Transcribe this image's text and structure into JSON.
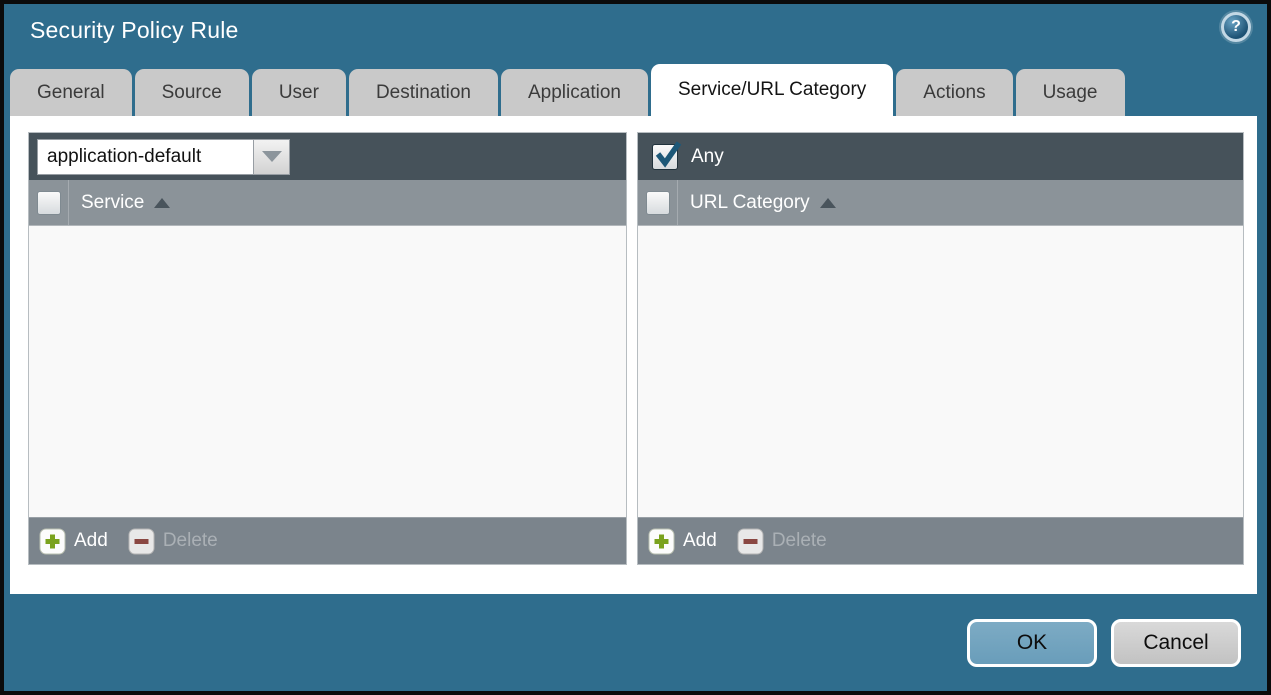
{
  "window": {
    "title": "Security Policy Rule"
  },
  "help": {
    "glyph": "?"
  },
  "tabs": [
    {
      "label": "General",
      "active": false
    },
    {
      "label": "Source",
      "active": false
    },
    {
      "label": "User",
      "active": false
    },
    {
      "label": "Destination",
      "active": false
    },
    {
      "label": "Application",
      "active": false
    },
    {
      "label": "Service/URL Category",
      "active": true
    },
    {
      "label": "Actions",
      "active": false
    },
    {
      "label": "Usage",
      "active": false
    }
  ],
  "service_panel": {
    "dropdown_value": "application-default",
    "column_header": "Service",
    "sort_order": "ascending",
    "rows": [],
    "add_label": "Add",
    "delete_label": "Delete",
    "delete_enabled": false
  },
  "url_category_panel": {
    "any_label": "Any",
    "any_checked": true,
    "column_header": "URL Category",
    "sort_order": "ascending",
    "rows": [],
    "add_label": "Add",
    "delete_label": "Delete",
    "delete_enabled": false
  },
  "footer": {
    "ok_label": "OK",
    "cancel_label": "Cancel"
  },
  "colors": {
    "frame_teal": "#2f6d8d",
    "dialog_border": "#0b0b0b",
    "toolbar_dark": "#46525a",
    "header_gray": "#8b9399",
    "footer_bar_gray": "#7b848c",
    "tab_inactive": "#c9c9c9",
    "tab_active": "#ffffff",
    "list_background": "#f9f9f9",
    "ok_button_blue": "#74a3bf",
    "cancel_button_gray": "#cccccc",
    "add_plus_green": "#7aa21e",
    "delete_minus_maroon": "#8a4742",
    "checkmark_blue": "#1d5878"
  }
}
